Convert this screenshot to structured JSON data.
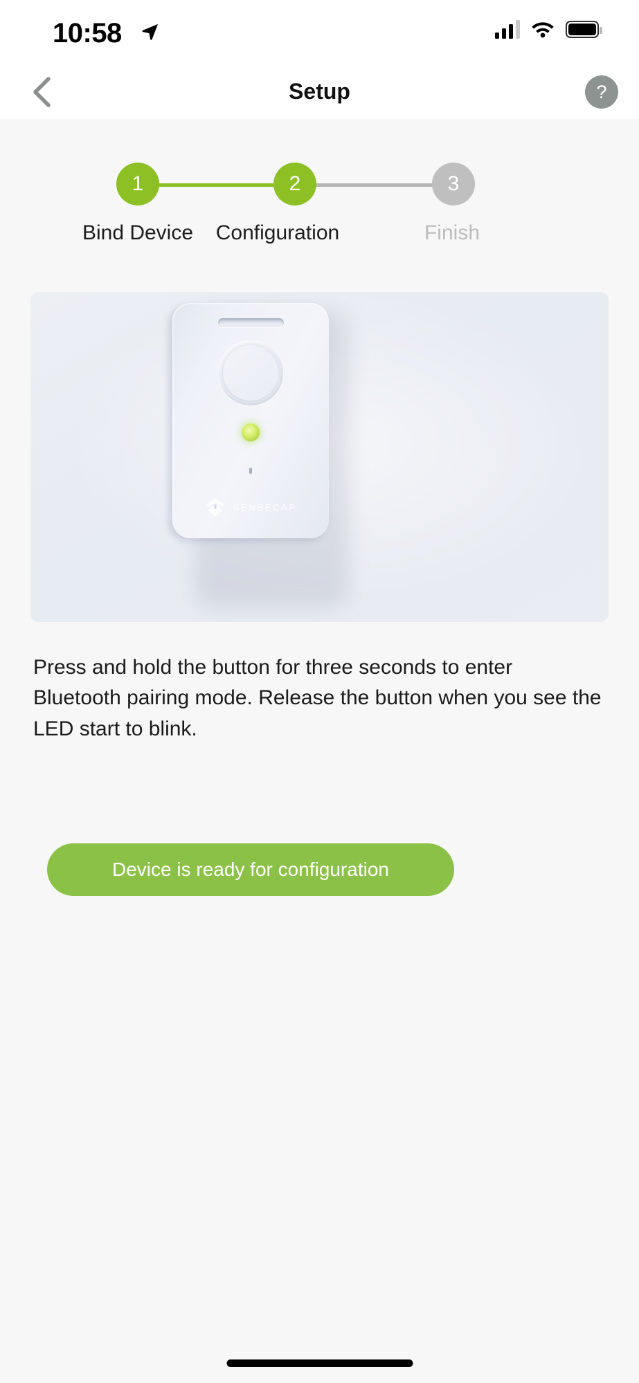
{
  "status_bar": {
    "time": "10:58",
    "location_icon": "location-arrow-icon",
    "cellular_icon": "cellular-signal-icon",
    "wifi_icon": "wifi-icon",
    "battery_icon": "battery-full-icon"
  },
  "nav_bar": {
    "back_icon": "chevron-left-icon",
    "title": "Setup",
    "help_label": "?",
    "help_icon": "question-mark-circle-icon"
  },
  "stepper": {
    "steps": [
      {
        "number": "1",
        "label": "Bind Device",
        "state": "complete"
      },
      {
        "number": "2",
        "label": "Configuration",
        "state": "active"
      },
      {
        "number": "3",
        "label": "Finish",
        "state": "inactive"
      }
    ],
    "active_color": "#8cc024",
    "inactive_color": "#bfbfbf",
    "connector_done_color": "#8cc024",
    "connector_todo_color": "#b5b5b5"
  },
  "device_image": {
    "alt": "SenseCAP card tracker device",
    "brand": "SENSECAP",
    "brand_mark": "sensecap-layers-logo-icon",
    "slot_name": "lanyard-slot",
    "button_name": "device-button",
    "led_name": "status-led",
    "led_color": "#c8e468",
    "background_color": "#e8ebf2"
  },
  "instructions": {
    "text": "Press and hold the button for three seconds to enter Bluetooth pairing mode. Release the button when you see the LED start to blink."
  },
  "cta": {
    "label": "Device is ready for configuration",
    "background_color": "#8cc147",
    "text_color": "#ffffff"
  },
  "home_indicator": {
    "name": "home-indicator"
  }
}
